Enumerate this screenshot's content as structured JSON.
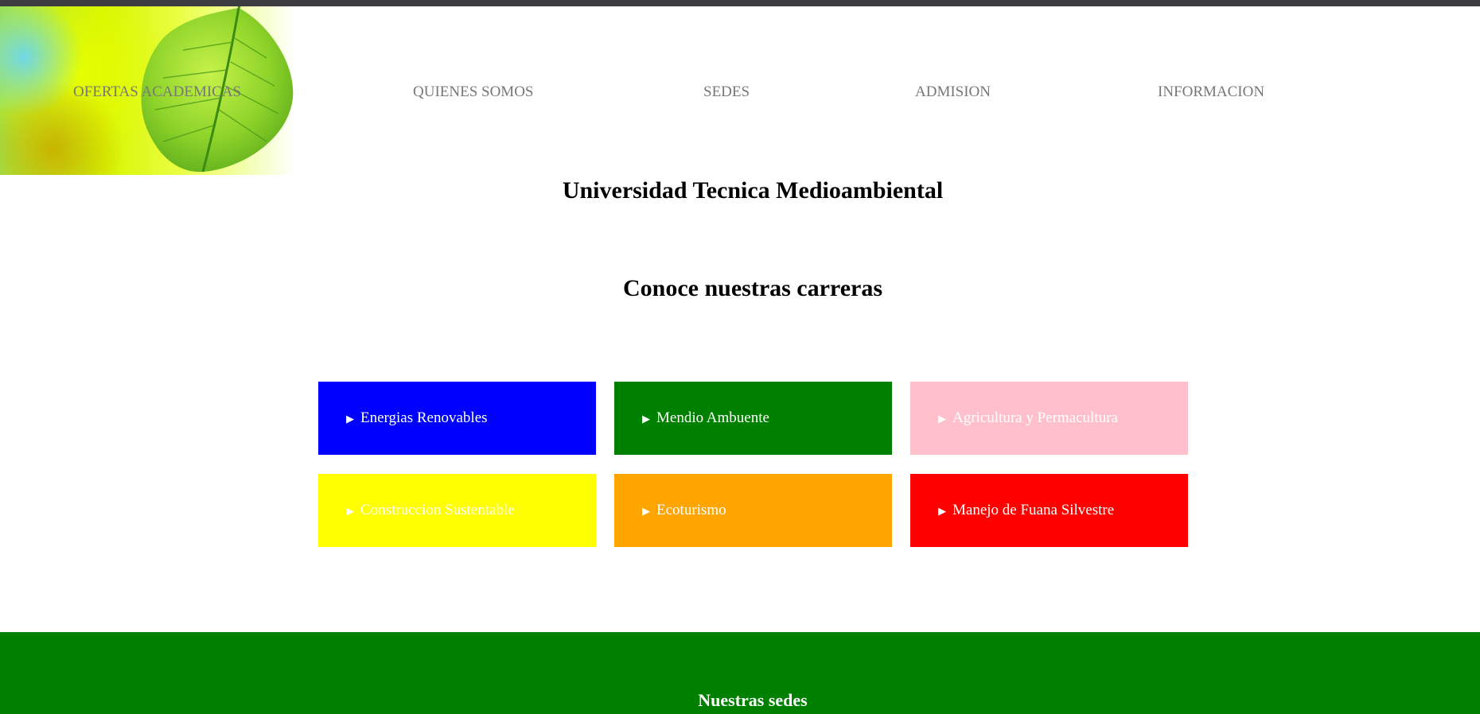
{
  "nav": {
    "items": [
      {
        "label": "OFERTAS ACADEMICAS"
      },
      {
        "label": "QUIENES SOMOS"
      },
      {
        "label": "SEDES"
      },
      {
        "label": "ADMISION"
      },
      {
        "label": "INFORMACION"
      }
    ]
  },
  "header": {
    "logo_icon": "leaf-image"
  },
  "main": {
    "site_title": "Universidad Tecnica Medioambiental",
    "section_title": "Conoce nuestras carreras",
    "careers": [
      {
        "label": "Energias Renovables",
        "color": "#0000ff",
        "icon": "triangle-right-icon"
      },
      {
        "label": "Mendio Ambuente",
        "color": "#008000",
        "icon": "triangle-right-icon"
      },
      {
        "label": "Agricultura y Permacultura",
        "color": "#ffc0cb",
        "icon": "triangle-right-icon"
      },
      {
        "label": "Construccion Sustentable",
        "color": "#ffff00",
        "icon": "triangle-right-icon"
      },
      {
        "label": "Ecoturismo",
        "color": "#ffa500",
        "icon": "triangle-right-icon"
      },
      {
        "label": "Manejo de Fuana Silvestre",
        "color": "#ff0000",
        "icon": "triangle-right-icon"
      }
    ]
  },
  "footer": {
    "title": "Nuestras sedes",
    "background_color": "#008000"
  }
}
